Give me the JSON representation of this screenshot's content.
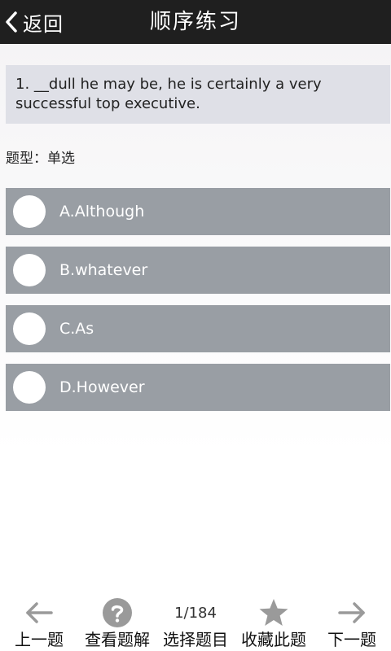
{
  "header": {
    "back_label": "返回",
    "title": "顺序练习"
  },
  "question": {
    "text": "1. __dull he may be, he is certainly a very successful top executive.",
    "type_label": "题型：单选"
  },
  "options": [
    {
      "label": "A.Although"
    },
    {
      "label": "B.whatever"
    },
    {
      "label": "C.As"
    },
    {
      "label": "D.However"
    }
  ],
  "bottom_bar": {
    "prev_label": "上一题",
    "explain_label": "查看题解",
    "counter": "1/184",
    "select_label": "选择题目",
    "favorite_label": "收藏此题",
    "next_label": "下一题"
  },
  "colors": {
    "header_bg": "#1f1f1f",
    "question_bg": "#dfe0e7",
    "option_bg": "#999ea4",
    "icon_gray": "#9a9a9a"
  },
  "icons": {
    "back": "chevron-left-icon",
    "prev": "arrow-left-icon",
    "explain": "help-circle-icon",
    "favorite": "star-icon",
    "next": "arrow-right-icon"
  }
}
